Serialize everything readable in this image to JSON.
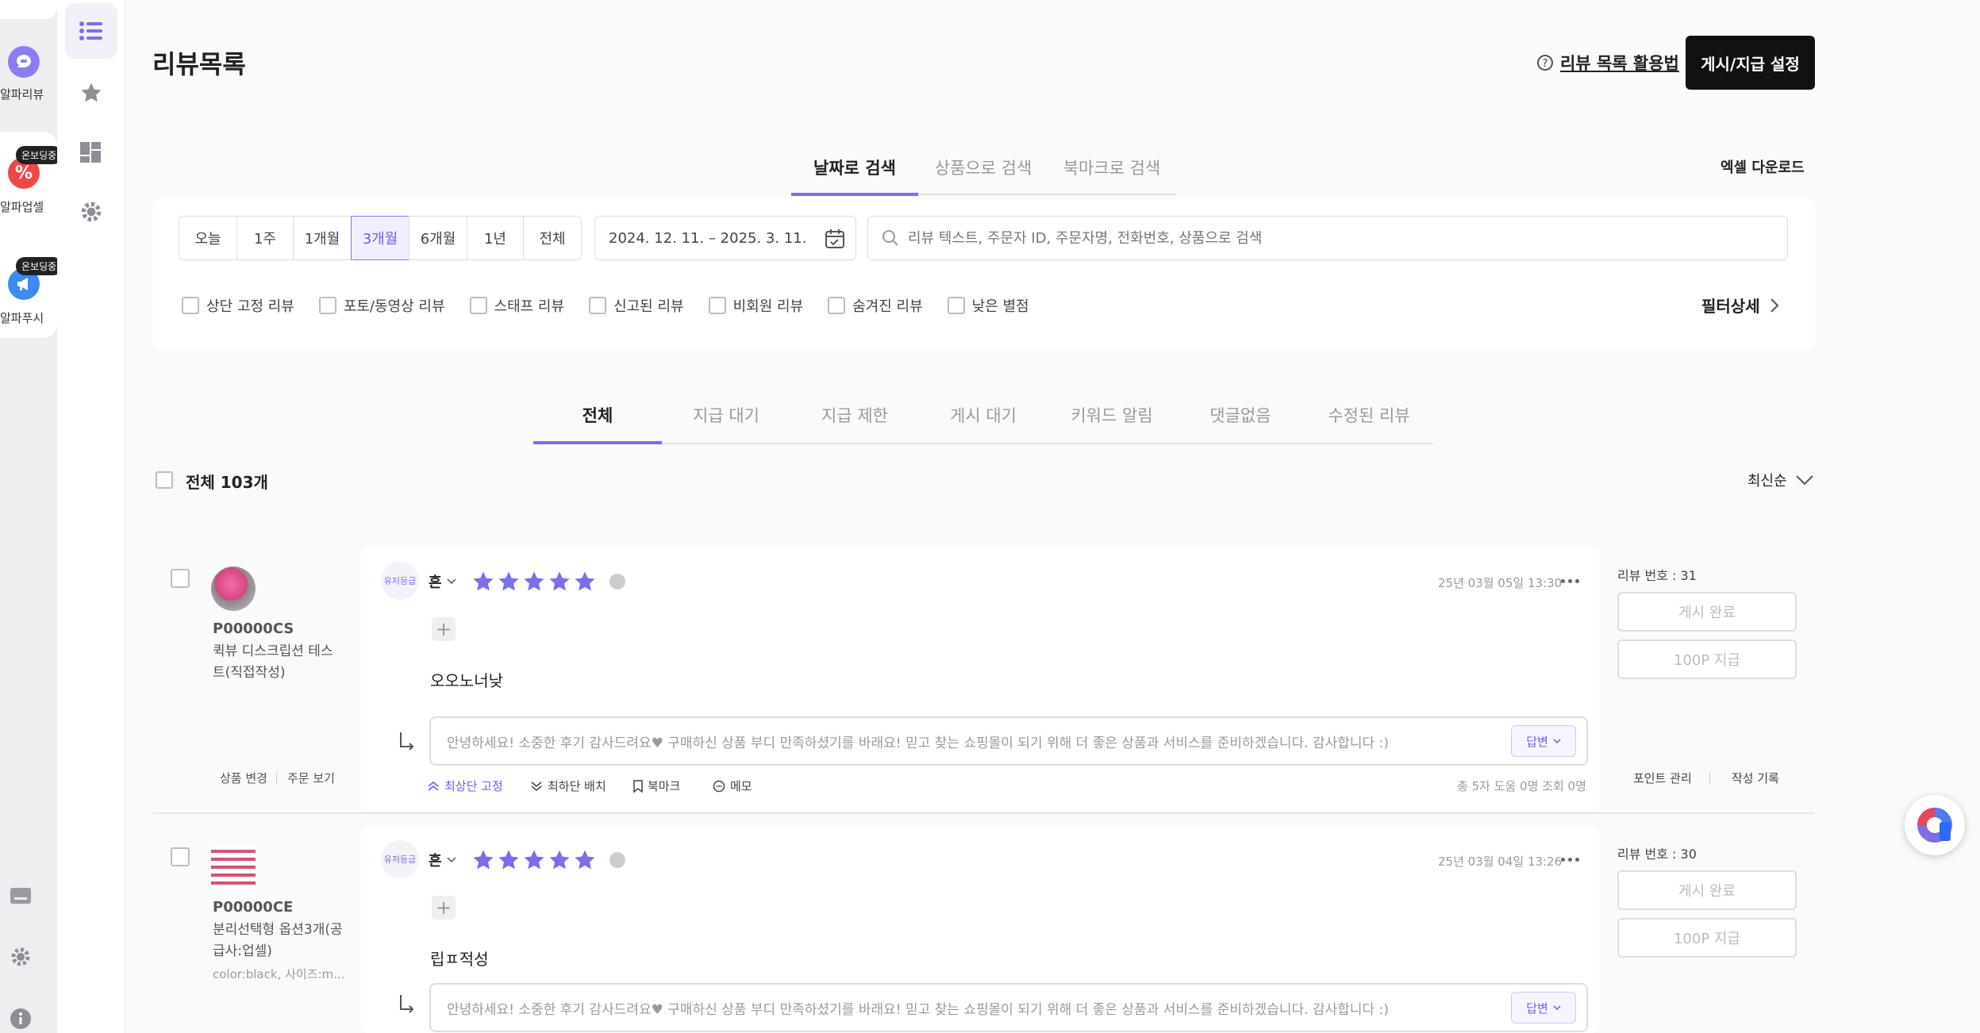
{
  "rail": {
    "apps": [
      {
        "label": "알파리뷰",
        "icon": "chat-bubble-icon"
      },
      {
        "label": "알파업셀",
        "icon": "percent-icon",
        "badge": "온보딩중"
      },
      {
        "label": "알파푸시",
        "icon": "megaphone-icon",
        "badge": "온보딩중"
      }
    ]
  },
  "header": {
    "title": "리뷰목록",
    "help_link": "리뷰 목록 활용법",
    "settings_button": "게시/지급 설정"
  },
  "search_tabs": [
    "날짜로 검색",
    "상품으로 검색",
    "북마크로 검색"
  ],
  "excel_download": "엑셀 다운로드",
  "periods": [
    "오늘",
    "1주",
    "1개월",
    "3개월",
    "6개월",
    "1년",
    "전체"
  ],
  "active_period": "3개월",
  "date_range": "2024. 12. 11. – 2025. 3. 11.",
  "search": {
    "placeholder": "리뷰 텍스트, 주문자 ID, 주문자명, 전화번호, 상품으로 검색"
  },
  "filters": [
    "상단 고정 리뷰",
    "포토/동영상 리뷰",
    "스태프 리뷰",
    "신고된 리뷰",
    "비회원 리뷰",
    "숨겨진 리뷰",
    "낮은 별점"
  ],
  "filter_detail": "필터상세",
  "status_tabs": [
    "전체",
    "지급 대기",
    "지급 제한",
    "게시 대기",
    "키워드 알림",
    "댓글없음",
    "수정된 리뷰"
  ],
  "total_label": "전체 103개",
  "sort": "최신순",
  "reviews": [
    {
      "product_code": "P00000CS",
      "product_name_1": "퀵뷰 디스크립션 테스",
      "product_name_2": "트(직접작성)",
      "product_option": "",
      "change_product": "상품 변경",
      "view_order": "주문 보기",
      "grade": "유저등급",
      "author": "흔",
      "rating": 5,
      "date": "25년 03월 05일 13:30",
      "text": "오오노너낮",
      "reply_placeholder": "안녕하세요! 소중한 후기 감사드려요♥ 구매하신 상품 부디 만족하셨기를 바래요! 믿고 찾는 쇼핑몰이 되기 위해 더 좋은 상품과 서비스를 준비하겠습니다. 감사합니다 :)",
      "reply_button": "답변",
      "actions": [
        "최상단 고정",
        "최하단 배치",
        "북마크",
        "메모"
      ],
      "stats": "총 5자  도움 0명  조회 0명",
      "review_no": "리뷰 번호 : 31",
      "publish_button": "게시 완료",
      "point_button": "100P 지급",
      "point_manage": "포인트 관리",
      "history": "작성 기록"
    },
    {
      "product_code": "P00000CE",
      "product_name_1": "분리선택형 옵션3개(공",
      "product_name_2": "급사:업셀)",
      "product_option": "color:black, 사이즈:m...",
      "grade": "유저등급",
      "author": "흔",
      "rating": 5,
      "date": "25년 03월 04일 13:26",
      "text": "립ㅍ적성",
      "reply_placeholder": "안녕하세요! 소중한 후기 감사드려요♥ 구매하신 상품 부디 만족하셨기를 바래요! 믿고 찾는 쇼핑몰이 되기 위해 더 좋은 상품과 서비스를 준비하겠습니다. 감사합니다 :)",
      "reply_button": "답변",
      "review_no": "리뷰 번호 : 30",
      "publish_button": "게시 완료",
      "point_button": "100P 지급"
    }
  ],
  "colors": {
    "accent": "#7b6ee8",
    "star": "#7b6ee8",
    "dark_button": "#111111"
  }
}
